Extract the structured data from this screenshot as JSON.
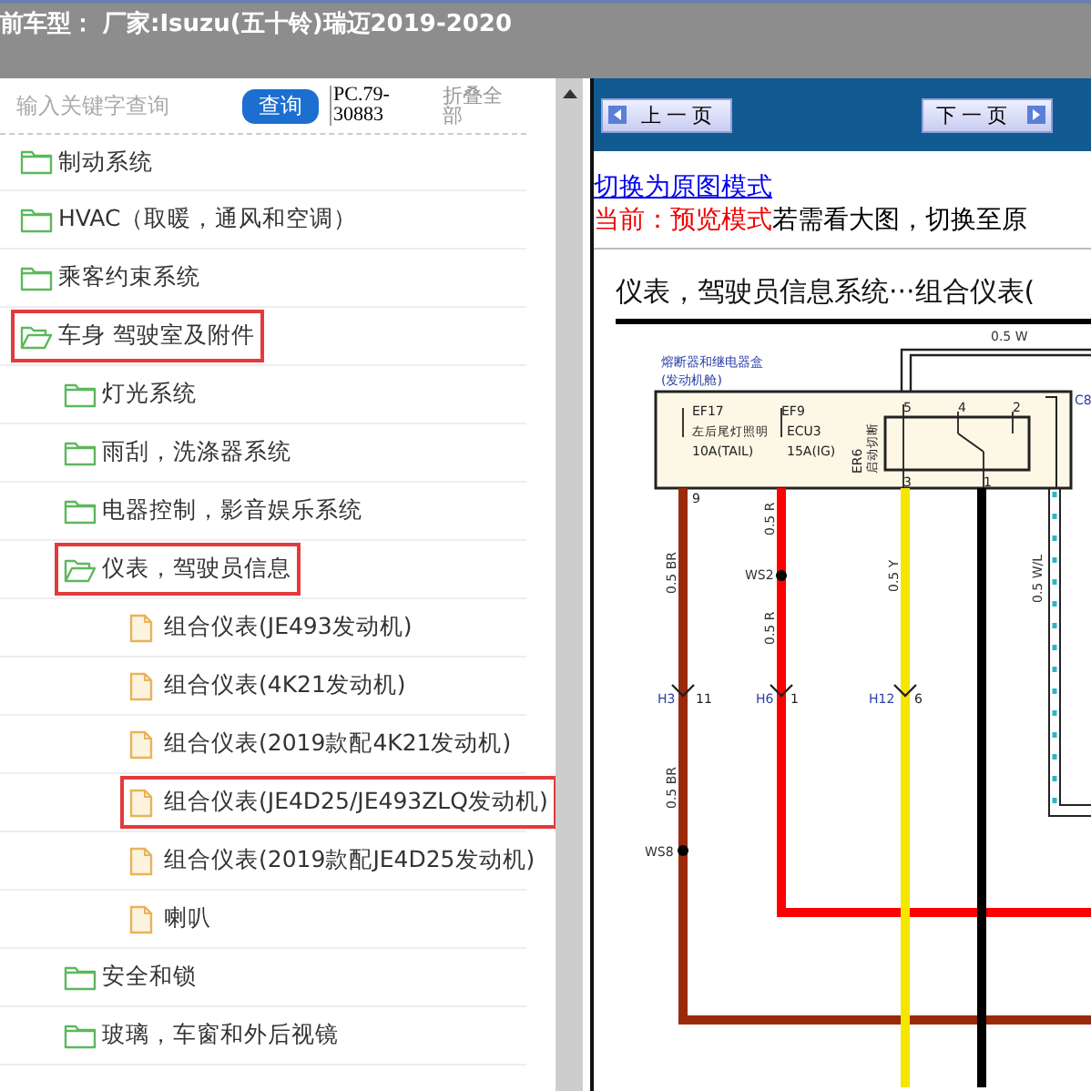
{
  "header": {
    "title": "前车型： 厂家:Isuzu(五十铃)瑞迈2019-2020"
  },
  "sidebar": {
    "search": {
      "placeholder": "输入关键字查询"
    },
    "search_button": "查询",
    "code": "PC.79-30883",
    "collapse_all": "折叠全部",
    "tree": [
      {
        "label": "制动系统",
        "kind": "folder",
        "expanded": false,
        "selected": false
      },
      {
        "label": "HVAC（取暖，通风和空调）",
        "kind": "folder",
        "expanded": false,
        "selected": false
      },
      {
        "label": "乘客约束系统",
        "kind": "folder",
        "expanded": false,
        "selected": false
      },
      {
        "label": "车身 驾驶室及附件",
        "kind": "folder",
        "expanded": true,
        "selected": true,
        "children": [
          {
            "label": "灯光系统",
            "kind": "folder",
            "expanded": false,
            "selected": false
          },
          {
            "label": "雨刮，洗涤器系统",
            "kind": "folder",
            "expanded": false,
            "selected": false
          },
          {
            "label": "电器控制，影音娱乐系统",
            "kind": "folder",
            "expanded": false,
            "selected": false
          },
          {
            "label": "仪表，驾驶员信息",
            "kind": "folder",
            "expanded": true,
            "selected": true,
            "children": [
              {
                "label": "组合仪表(JE493发动机)",
                "kind": "document",
                "selected": false
              },
              {
                "label": "组合仪表(4K21发动机)",
                "kind": "document",
                "selected": false
              },
              {
                "label": "组合仪表(2019款配4K21发动机)",
                "kind": "document",
                "selected": false
              },
              {
                "label": "组合仪表(JE4D25/JE493ZLQ发动机)",
                "kind": "document",
                "selected": true
              },
              {
                "label": "组合仪表(2019款配JE4D25发动机)",
                "kind": "document",
                "selected": false
              },
              {
                "label": "喇叭",
                "kind": "document",
                "selected": false
              }
            ]
          },
          {
            "label": "安全和锁",
            "kind": "folder",
            "expanded": false,
            "selected": false
          },
          {
            "label": "玻璃，车窗和外后视镜",
            "kind": "folder",
            "expanded": false,
            "selected": false
          }
        ]
      }
    ]
  },
  "viewer": {
    "prev_button": "上一页",
    "next_button": "下一页",
    "mode_link": "切换为原图模式",
    "mode_current": "当前：预览模式",
    "mode_hint": "若需看大图，切换至原",
    "diagram": {
      "title": "仪表，驾驶员信息系统···组合仪表(",
      "labels": [
        "熔断器和继电器盒",
        "(发动机舱)",
        "0.5 W",
        "C8",
        "EF17",
        "左后尾灯照明",
        "10A(TAIL)",
        "EF9",
        "ECU3",
        "15A(IG)",
        "ER6",
        "启动切断",
        "5",
        "4",
        "2",
        "3",
        "1",
        "9",
        "0.5 BR",
        "0.5 R",
        "WS2",
        "0.5 R",
        "0.5 Y",
        "0.5 W/L",
        "H3",
        "11",
        "H6",
        "1",
        "H12",
        "6",
        "0.5 BR",
        "WS8"
      ]
    }
  }
}
